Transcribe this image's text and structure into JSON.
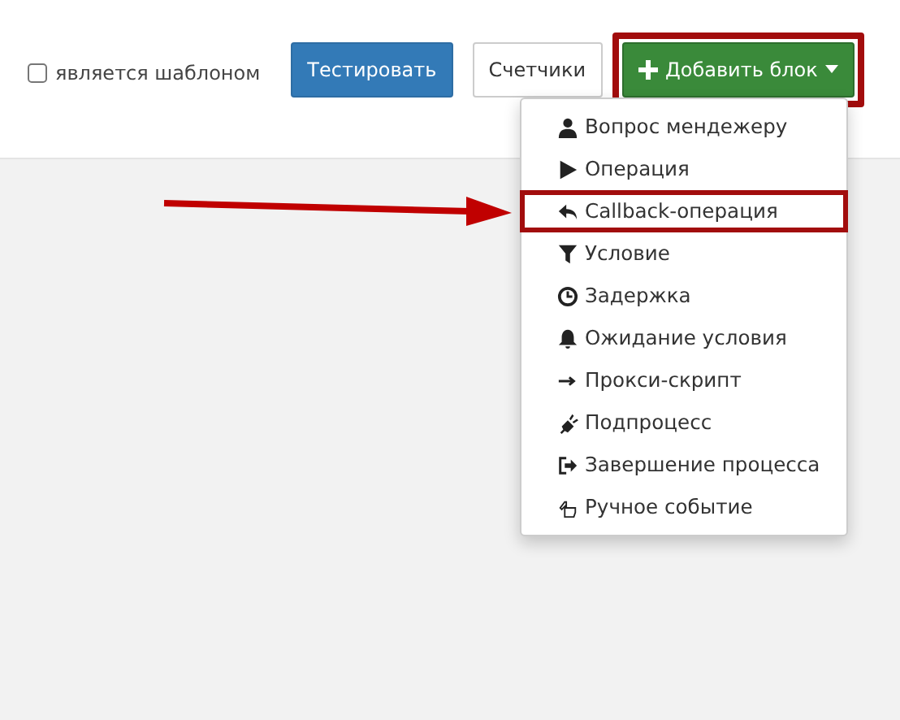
{
  "toolbar": {
    "template_checkbox": {
      "label": "является шаблоном",
      "checked": false
    },
    "buttons": [
      {
        "label": "Тестировать",
        "kind": "primary"
      },
      {
        "label": "Счетчики",
        "kind": "default"
      },
      {
        "label": "Добавить блок",
        "kind": "success",
        "highlighted": true
      }
    ]
  },
  "dropdown": {
    "items": [
      {
        "label": "Вопрос мендежеру",
        "highlighted": false
      },
      {
        "label": "Операция",
        "highlighted": false
      },
      {
        "label": "Callback-операция",
        "highlighted": true
      },
      {
        "label": "Условие",
        "highlighted": false
      },
      {
        "label": "Задержка",
        "highlighted": false
      },
      {
        "label": "Ожидание условия",
        "highlighted": false
      },
      {
        "label": "Прокси-скрипт",
        "highlighted": false
      },
      {
        "label": "Подпроцесс",
        "highlighted": false
      },
      {
        "label": "Завершение процесса",
        "highlighted": false
      },
      {
        "label": "Ручное событие",
        "highlighted": false
      }
    ]
  }
}
